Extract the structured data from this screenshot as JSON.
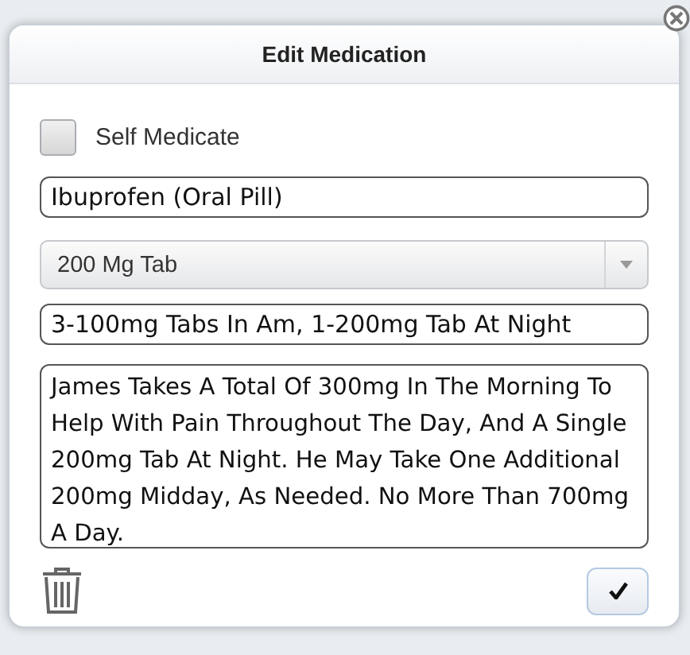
{
  "dialog": {
    "title": "Edit Medication",
    "self_medicate": {
      "label": "Self Medicate",
      "checked": false
    },
    "medication": {
      "value": "Ibuprofen (Oral Pill)"
    },
    "dose": {
      "value": "200 Mg Tab"
    },
    "instructions": {
      "value": "3-100mg Tabs In Am, 1-200mg Tab At Night"
    },
    "notes": {
      "value": "James Takes A Total Of 300mg In The Morning To Help With Pain Throughout The Day, And A Single 200mg Tab At Night. He May Take One Additional 200mg Midday, As Needed. No More Than 700mg A Day."
    }
  }
}
